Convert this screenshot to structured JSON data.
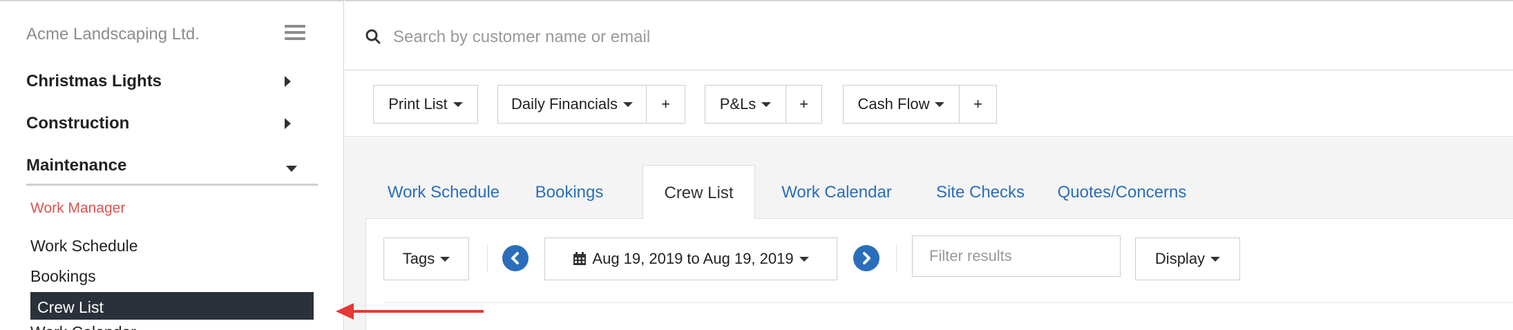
{
  "sidebar": {
    "company": "Acme Landscaping Ltd.",
    "sections": [
      {
        "label": "Christmas Lights",
        "state": "collapsed"
      },
      {
        "label": "Construction",
        "state": "collapsed"
      },
      {
        "label": "Maintenance",
        "state": "expanded"
      }
    ],
    "subheader": "Work Manager",
    "items": [
      "Work Schedule",
      "Bookings",
      "Crew List",
      "Work Calendar"
    ],
    "active_item": "Crew List"
  },
  "search": {
    "placeholder": "Search by customer name or email"
  },
  "reports": {
    "print_list": "Print List",
    "daily_financials": "Daily Financials",
    "pls": "P&Ls",
    "cash_flow": "Cash Flow",
    "add_label": "+"
  },
  "tabs": [
    {
      "label": "Work Schedule",
      "active": false
    },
    {
      "label": "Bookings",
      "active": false
    },
    {
      "label": "Crew List",
      "active": true
    },
    {
      "label": "Work Calendar",
      "active": false
    },
    {
      "label": "Site Checks",
      "active": false
    },
    {
      "label": "Quotes/Concerns",
      "active": false
    }
  ],
  "toolbar": {
    "tags_label": "Tags",
    "date_range": "Aug 19, 2019 to Aug 19, 2019",
    "filter_placeholder": "Filter results",
    "display_label": "Display"
  },
  "colors": {
    "accent": "#2a6ebb",
    "active_bg": "#2b313a",
    "subheader": "#d9534f",
    "annotation": "#e53935"
  },
  "icons": [
    "hamburger-icon",
    "caret-right-icon",
    "caret-down-icon",
    "search-icon",
    "chevron-left-icon",
    "chevron-right-icon",
    "calendar-icon"
  ]
}
